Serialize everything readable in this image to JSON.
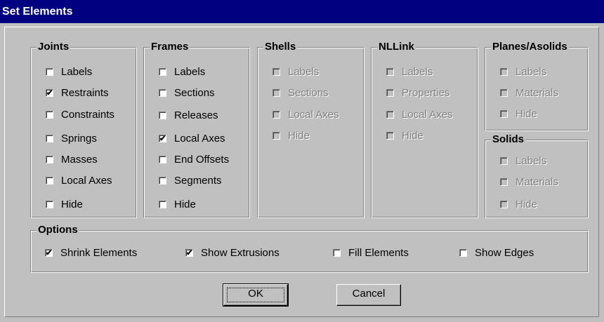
{
  "window": {
    "title": "Set Elements"
  },
  "groups": {
    "joints": {
      "title": "Joints",
      "items": [
        {
          "label": "Labels",
          "checked": false
        },
        {
          "label": "Restraints",
          "checked": true
        },
        {
          "label": "Constraints",
          "checked": false
        },
        {
          "label": "Springs",
          "checked": false
        },
        {
          "label": "Masses",
          "checked": false
        },
        {
          "label": "Local Axes",
          "checked": false
        },
        {
          "label": "Hide",
          "checked": false
        }
      ]
    },
    "frames": {
      "title": "Frames",
      "items": [
        {
          "label": "Labels",
          "checked": false
        },
        {
          "label": "Sections",
          "checked": false
        },
        {
          "label": "Releases",
          "checked": false
        },
        {
          "label": "Local Axes",
          "checked": true
        },
        {
          "label": "End Offsets",
          "checked": false
        },
        {
          "label": "Segments",
          "checked": false
        },
        {
          "label": "Hide",
          "checked": false
        }
      ]
    },
    "shells": {
      "title": "Shells",
      "disabled": true,
      "items": [
        {
          "label": "Labels",
          "checked": false
        },
        {
          "label": "Sections",
          "checked": false
        },
        {
          "label": "Local Axes",
          "checked": false
        },
        {
          "label": "Hide",
          "checked": false
        }
      ]
    },
    "nllink": {
      "title": "NLLink",
      "disabled": true,
      "items": [
        {
          "label": "Labels",
          "checked": false
        },
        {
          "label": "Properties",
          "checked": false
        },
        {
          "label": "Local Axes",
          "checked": false
        },
        {
          "label": "Hide",
          "checked": false
        }
      ]
    },
    "planes": {
      "title": "Planes/Asolids",
      "disabled": true,
      "items": [
        {
          "label": "Labels",
          "checked": false
        },
        {
          "label": "Materials",
          "checked": false
        },
        {
          "label": "Hide",
          "checked": false
        }
      ]
    },
    "solids": {
      "title": "Solids",
      "disabled": true,
      "items": [
        {
          "label": "Labels",
          "checked": false
        },
        {
          "label": "Materials",
          "checked": false
        },
        {
          "label": "Hide",
          "checked": false
        }
      ]
    },
    "options": {
      "title": "Options",
      "items": [
        {
          "label": "Shrink Elements",
          "checked": true
        },
        {
          "label": "Show Extrusions",
          "checked": true
        },
        {
          "label": "Fill Elements",
          "checked": false
        },
        {
          "label": "Show Edges",
          "checked": false
        }
      ]
    }
  },
  "buttons": {
    "ok": "OK",
    "cancel": "Cancel"
  },
  "check_glyph": "✔",
  "colors": {
    "titlebar": "#000080",
    "face": "#c0c0c0",
    "disabled_text": "#808080"
  }
}
